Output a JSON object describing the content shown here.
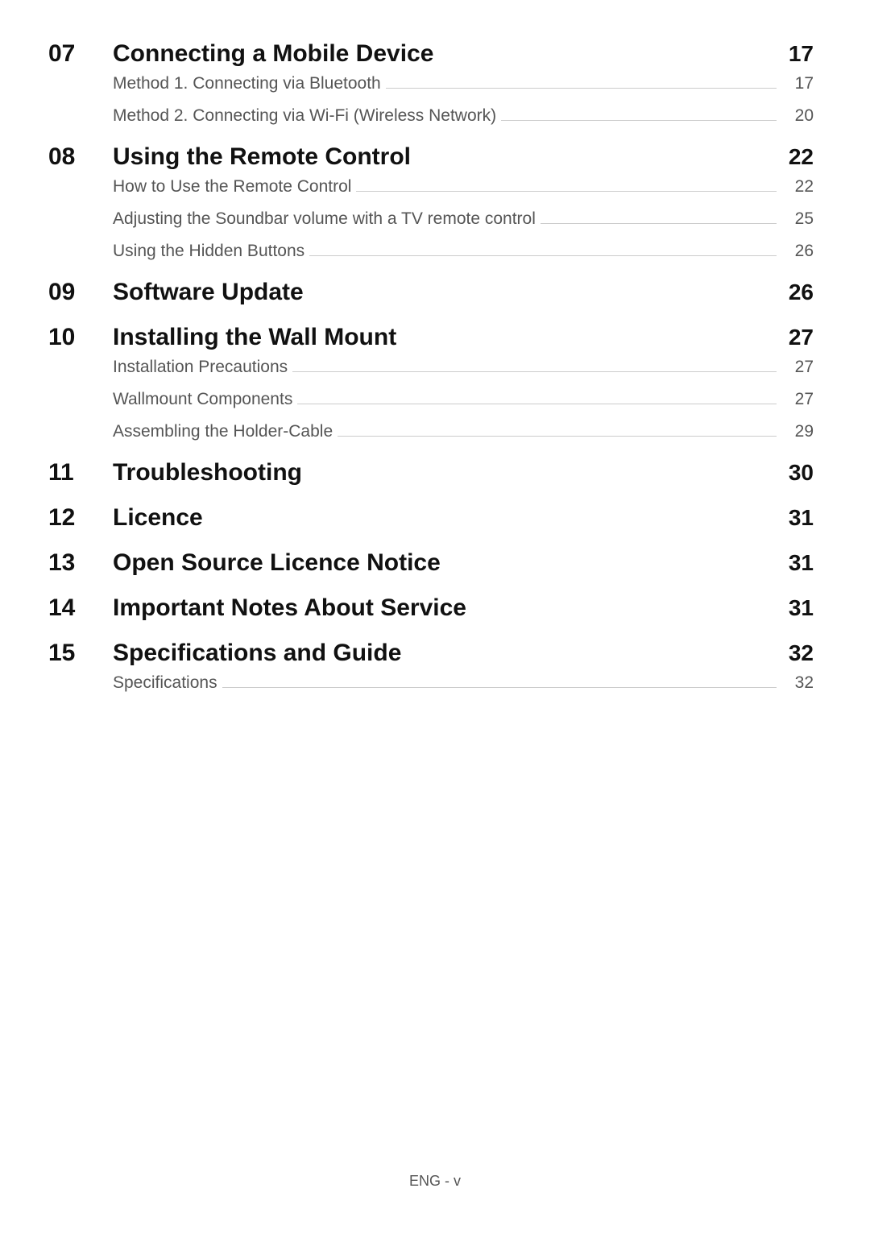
{
  "sections": [
    {
      "num": "07",
      "title": "Connecting a Mobile Device",
      "page": "17",
      "subs": [
        {
          "title": "Method 1. Connecting via Bluetooth",
          "page": "17"
        },
        {
          "title": "Method 2. Connecting via Wi-Fi (Wireless Network)",
          "page": "20"
        }
      ]
    },
    {
      "num": "08",
      "title": "Using the Remote Control",
      "page": "22",
      "subs": [
        {
          "title": "How to Use the Remote Control",
          "page": "22"
        },
        {
          "title": "Adjusting the Soundbar volume with a TV remote control",
          "page": "25"
        },
        {
          "title": "Using the Hidden Buttons",
          "page": "26"
        }
      ]
    },
    {
      "num": "09",
      "title": "Software Update",
      "page": "26",
      "subs": []
    },
    {
      "num": "10",
      "title": "Installing the Wall Mount",
      "page": "27",
      "subs": [
        {
          "title": "Installation Precautions",
          "page": "27"
        },
        {
          "title": "Wallmount Components",
          "page": "27"
        },
        {
          "title": "Assembling the Holder-Cable",
          "page": "29"
        }
      ]
    },
    {
      "num": "11",
      "title": "Troubleshooting",
      "page": "30",
      "subs": []
    },
    {
      "num": "12",
      "title": "Licence",
      "page": "31",
      "subs": []
    },
    {
      "num": "13",
      "title": "Open Source Licence Notice",
      "page": "31",
      "subs": []
    },
    {
      "num": "14",
      "title": "Important Notes About Service",
      "page": "31",
      "subs": []
    },
    {
      "num": "15",
      "title": "Specifications and Guide",
      "page": "32",
      "subs": [
        {
          "title": "Specifications",
          "page": "32"
        }
      ]
    }
  ],
  "footer": "ENG - v"
}
